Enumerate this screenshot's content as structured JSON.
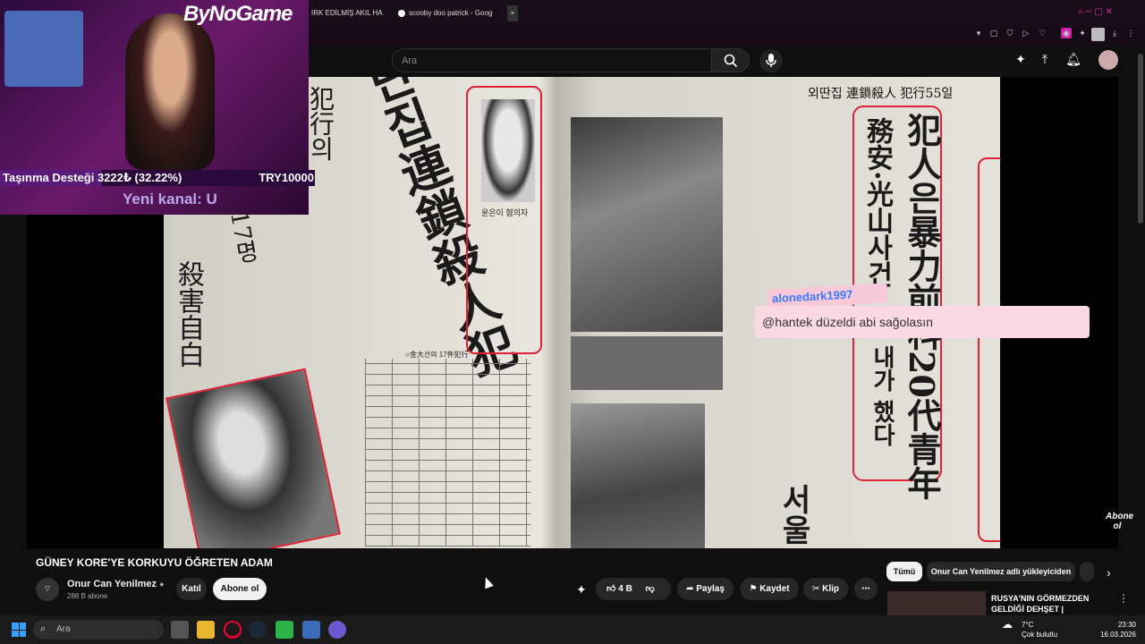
{
  "browser": {
    "tabs": [
      {
        "label": "IRK EDİLMİŞ AKIL HA"
      },
      {
        "label": "scooby doo patrick - Goog"
      }
    ],
    "new_tab": "+"
  },
  "overlay": {
    "logo_text": "ByNoGame",
    "donation_label": "Taşınma Desteği 3222₺ (32.22%)",
    "donation_goal": "TRY10000",
    "donation_progress": 0.3222,
    "new_channel": "Yeni kanal: U",
    "chat_user": "alonedark1997",
    "chat_message": "@hantek düzeldi abi sağolasın"
  },
  "youtube": {
    "search_placeholder": "Ara",
    "video_title": "GÜNEY KORE'YE KORKUYU ÖĞRETEN ADAM",
    "channel_name": "Onur Can Yenilmez",
    "subscribers": "288 B abone",
    "join_label": "Katıl",
    "subscribe_label": "Abone ol",
    "likes": "4 B",
    "share_label": "Paylaş",
    "save_label": "Kaydet",
    "clip_label": "Klip",
    "chips": [
      "Tümü",
      "Onur Can Yenilmez adlı yükleyiciden"
    ],
    "rec_title": "RUSYA'NIN GÖRMEZDEN GELDİĞİ DEHŞET | ALEXANDE...",
    "watermark": "Abone ol"
  },
  "newspaper": {
    "headline_left": "단집連鎖殺人犯",
    "col_left2": "犯行의",
    "col_left3": "殺害自白",
    "col_left4": "17명",
    "caption_face": "윤은이 혐의자",
    "headline_right": "犯人은暴力前科20代青年",
    "col_right2": "務安·光山사건",
    "col_right3": "내가 했다",
    "col_right_bottom": "서울",
    "top_right": "외딴집 連鎖殺人 犯行55일",
    "table_title": "○金大선의 17件犯行"
  },
  "taskbar": {
    "search_placeholder": "Ara",
    "temp": "7°C",
    "weather": "Çok bulutlu",
    "time": "23:30",
    "date": "16.03.2026"
  }
}
